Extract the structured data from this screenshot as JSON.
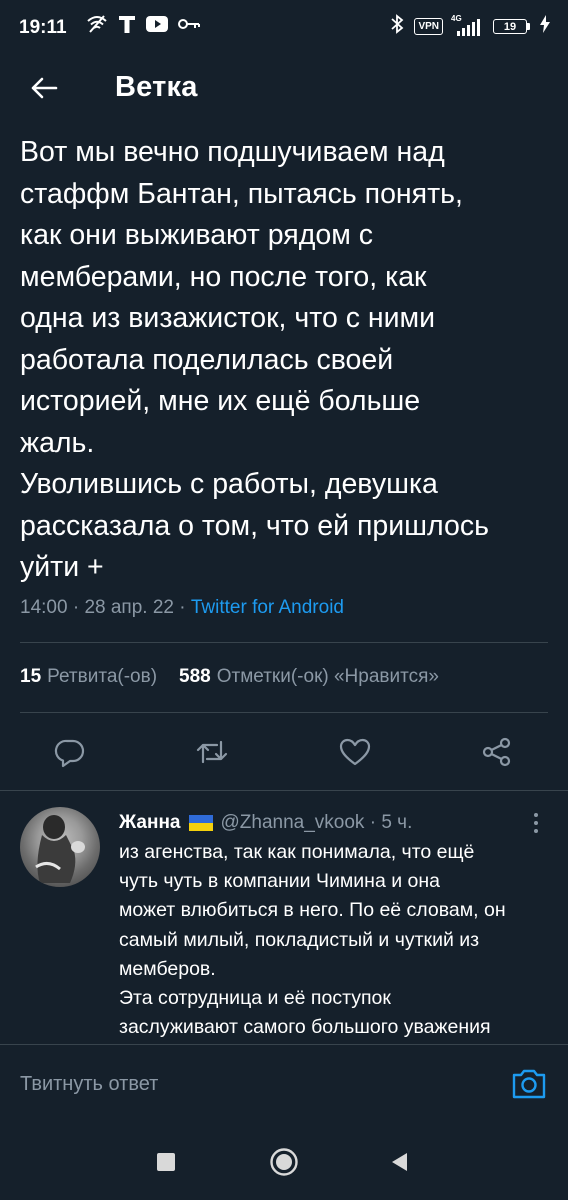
{
  "status_bar": {
    "time": "19:11",
    "left_icons": [
      "wifi-off-icon",
      "t-mobile-icon",
      "youtube-icon",
      "vpn-key-icon"
    ],
    "vpn_label": "VPN",
    "network": "4G",
    "battery": "19",
    "right_icons": [
      "bluetooth-icon",
      "signal-icon",
      "charging-icon"
    ]
  },
  "header": {
    "title": "Ветка"
  },
  "tweet": {
    "text": "Вот мы вечно подшучиваем над\nстаффм Бантан, пытаясь понять,\nкак они выживают рядом с\nмемберами, но после того, как\nодна из визажисток, что с ними\nработала поделилась своей\nисторией, мне их ещё больше\nжаль.\nУволившись с работы, девушка\nрассказала о том, что ей пришлось\nуйти +",
    "time": "14:00",
    "date": "28 апр. 22",
    "separator": " · ",
    "source": "Twitter for Android",
    "retweets_count": "15",
    "retweets_label": "Ретвита(-ов)",
    "likes_count": "588",
    "likes_label": "Отметки(-ок) «Нравится»",
    "actions": [
      "reply-icon",
      "retweet-icon",
      "like-icon",
      "share-icon"
    ]
  },
  "reply": {
    "name": "Жанна",
    "handle": "@Zhanna_vkook",
    "separator": " · ",
    "time": "5 ч.",
    "text": "из агенства, так как понимала, что ещё\nчуть чуть в компании Чимина и она\nможет влюбиться в него. По её словам, он\nсамый милый, покладистый и чуткий из\nмемберов.\nЭта сотрудница и её поступок\nзаслуживают самого большого уважения"
  },
  "compose": {
    "placeholder": "Твитнуть ответ"
  },
  "colors": {
    "background": "#15202b",
    "text": "#ffffff",
    "secondary": "#8b98a5",
    "accent": "#1d9bf0",
    "divider": "#38444d"
  }
}
